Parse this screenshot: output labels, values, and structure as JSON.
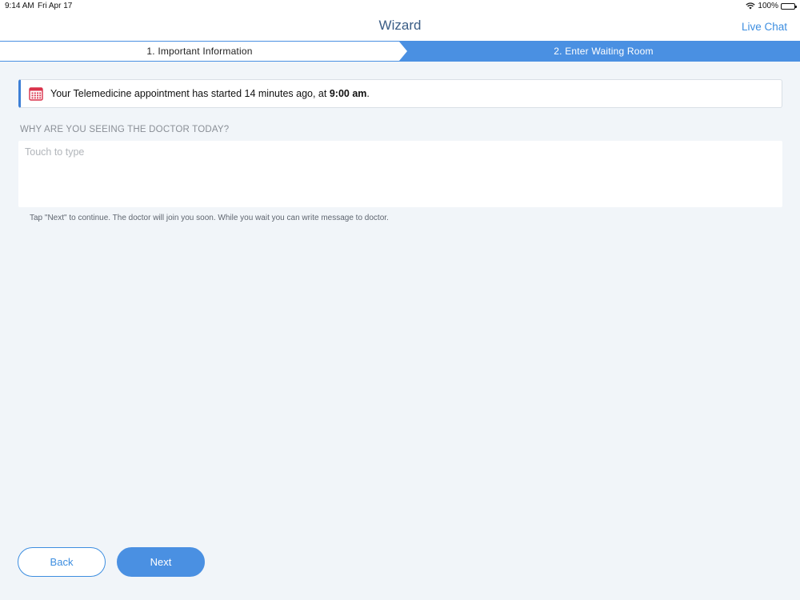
{
  "status_bar": {
    "time": "9:14 AM",
    "date": "Fri Apr 17",
    "battery": "100%",
    "wifi_icon": "wifi-icon",
    "battery_icon": "battery-icon"
  },
  "nav": {
    "title": "Wizard",
    "live_chat": "Live Chat"
  },
  "steps": [
    {
      "label": "1. Important Information",
      "active": false
    },
    {
      "label": "2. Enter Waiting Room",
      "active": true
    }
  ],
  "info": {
    "icon": "calendar-icon",
    "message_prefix": "Your Telemedicine appointment has started 14 minutes ago, at ",
    "time": "9:00 am",
    "message_suffix": "."
  },
  "reason": {
    "label": "WHY ARE YOU SEEING THE DOCTOR TODAY?",
    "placeholder": "Touch to type",
    "value": ""
  },
  "hint": "Tap \"Next\" to continue. The doctor will join you soon. While you wait you can write message to doctor.",
  "buttons": {
    "back": "Back",
    "next": "Next"
  },
  "colors": {
    "accent": "#4a90e2",
    "background": "#f1f5f9",
    "calendar": "#d9314a"
  }
}
